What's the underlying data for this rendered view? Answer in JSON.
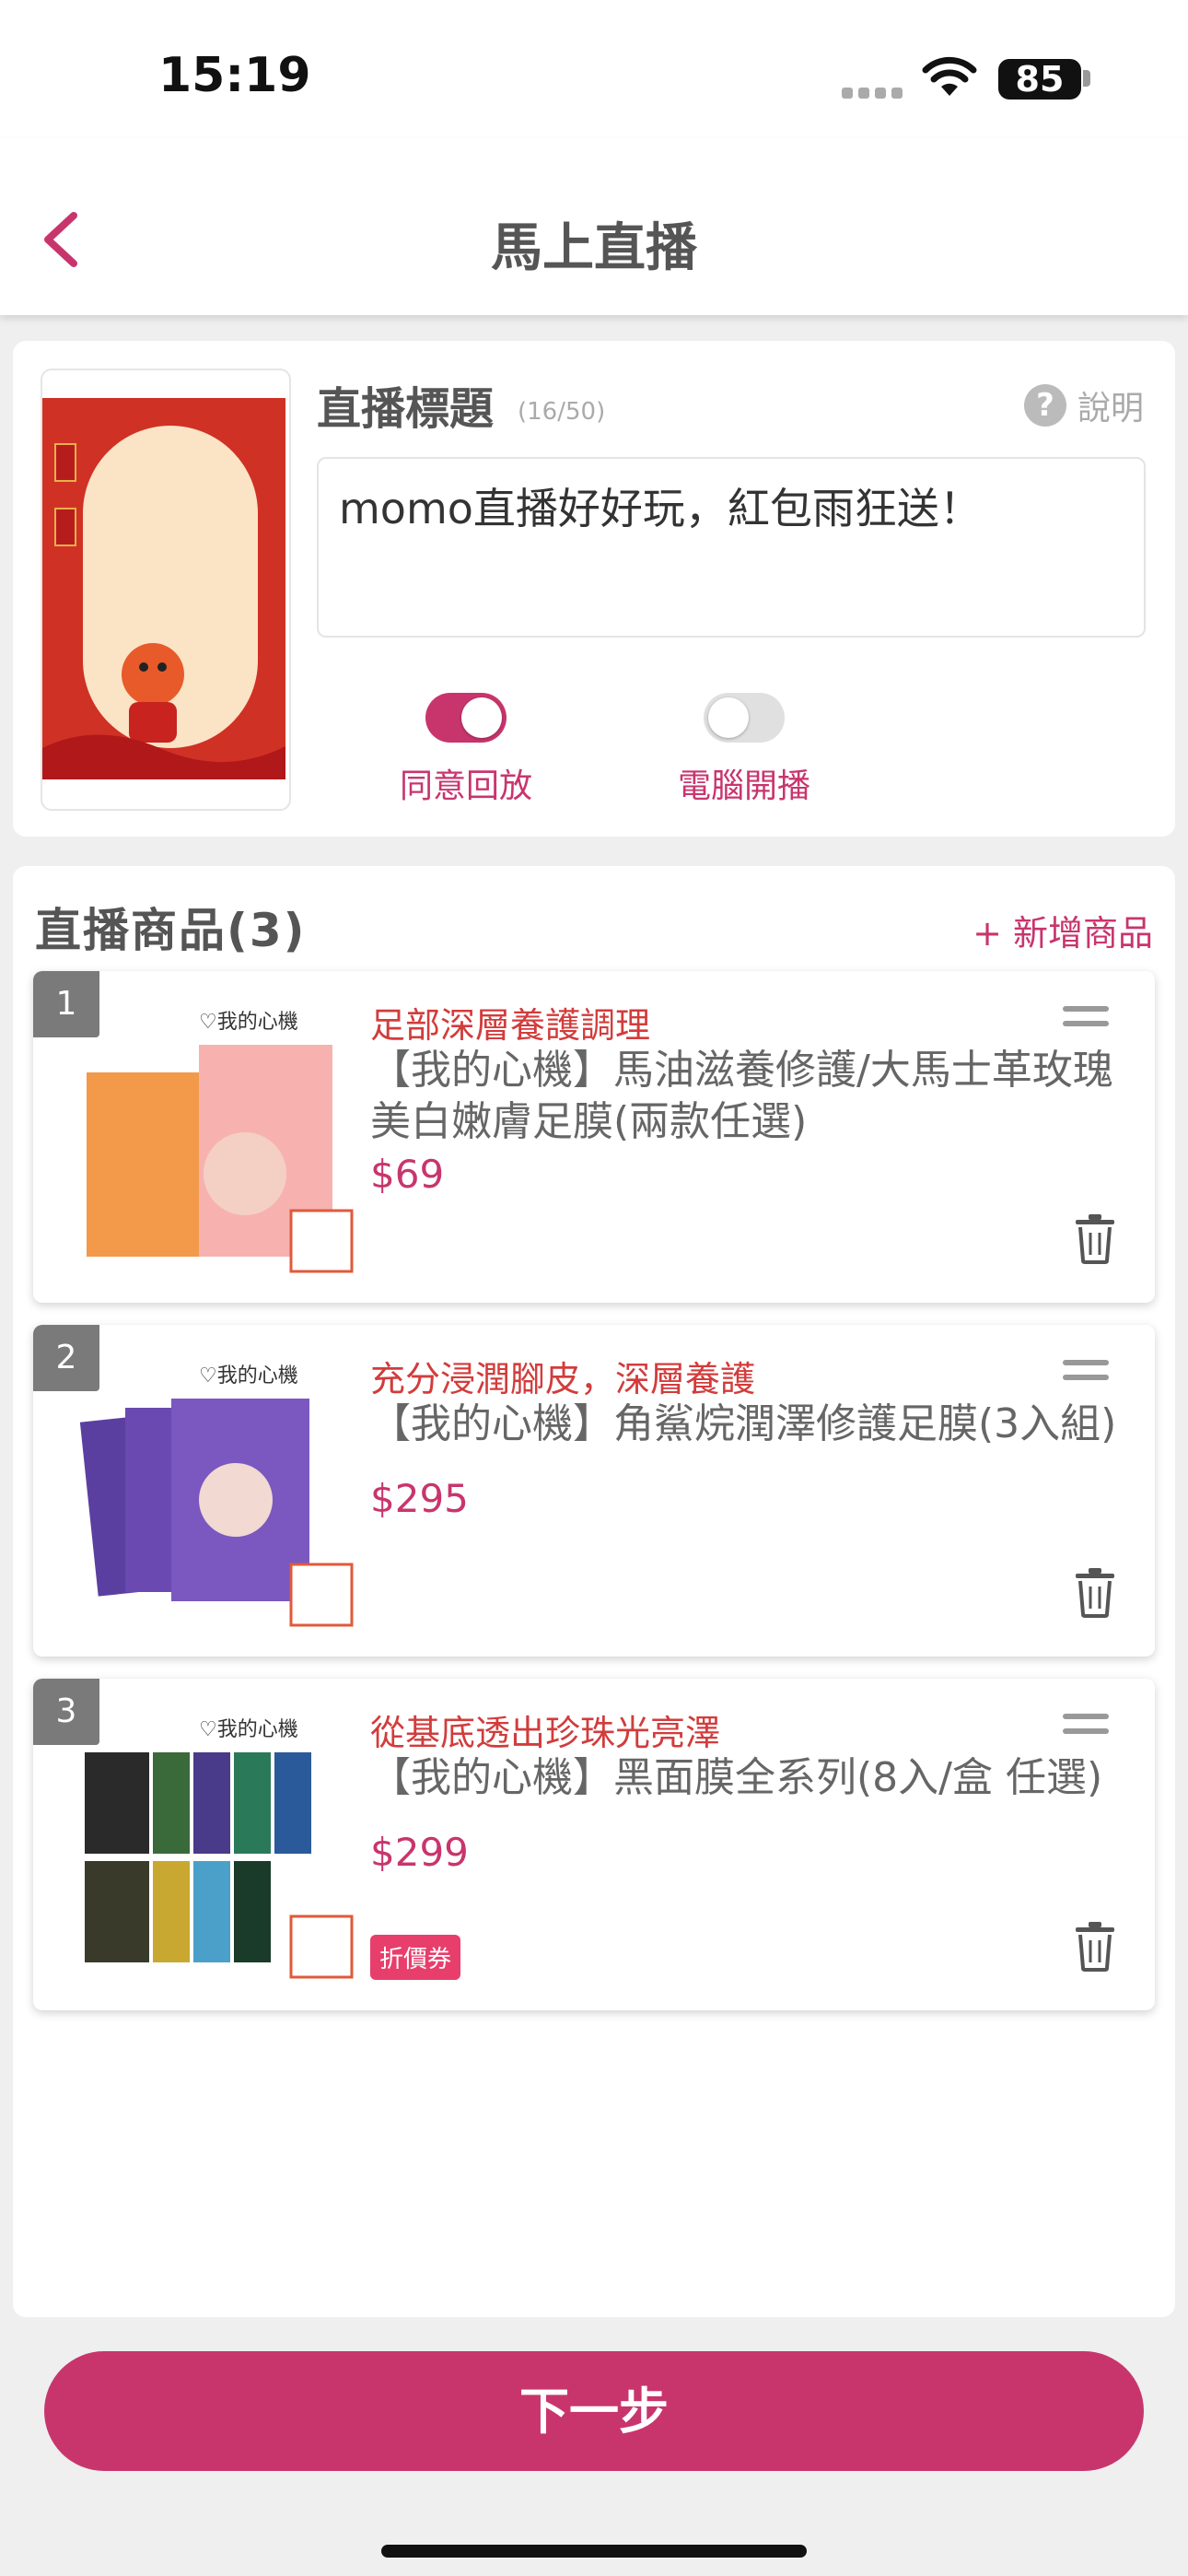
{
  "status_bar": {
    "time": "15:19",
    "battery": "85"
  },
  "nav": {
    "title": "馬上直播"
  },
  "live": {
    "title_label": "直播標題",
    "title_count": "(16/50)",
    "help_label": "說明",
    "title_value": "momo直播好好玩，紅包雨狂送！",
    "toggles": [
      {
        "label": "同意回放",
        "on": true
      },
      {
        "label": "電腦開播",
        "on": false
      }
    ]
  },
  "products": {
    "header": "直播商品(3)",
    "add_label": "+ 新增商品",
    "items": [
      {
        "index": "1",
        "tag": "足部深層養護調理",
        "name": "【我的心機】馬油滋養修護/大馬士革玫瑰美白嫩膚足膜(兩款任選)",
        "price": "$69",
        "badge": ""
      },
      {
        "index": "2",
        "tag": "充分浸潤腳皮，深層養護",
        "name": "【我的心機】角鯊烷潤澤修護足膜(3入組)",
        "price": "$295",
        "badge": ""
      },
      {
        "index": "3",
        "tag": "從基底透出珍珠光亮澤",
        "name": "【我的心機】黑面膜全系列(8入/盒 任選)",
        "price": "$299",
        "badge": "折價券"
      }
    ]
  },
  "footer": {
    "next_label": "下一步"
  },
  "colors": {
    "accent": "#c8356d",
    "tag_red": "#d23c3c"
  }
}
